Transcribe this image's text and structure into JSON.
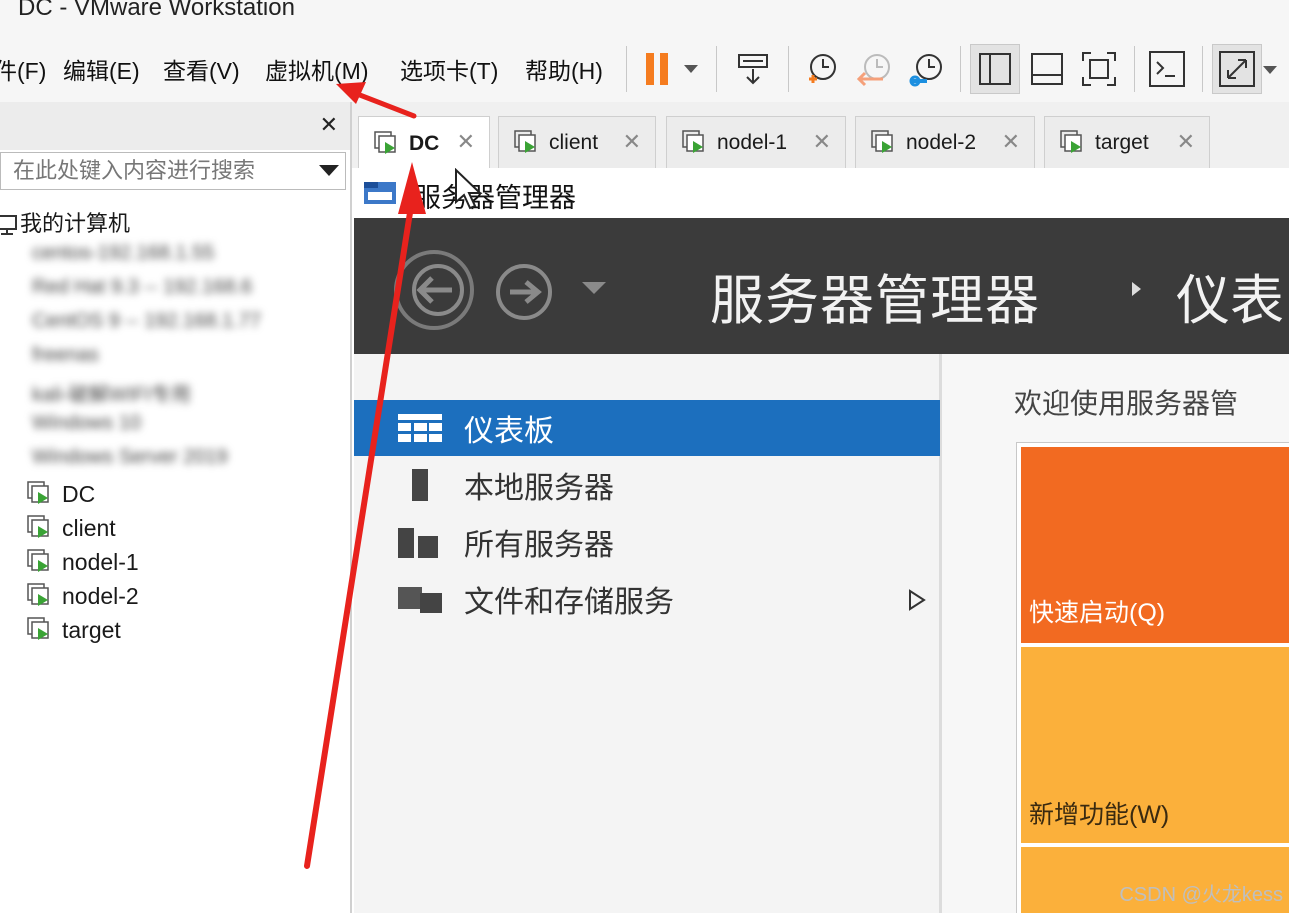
{
  "window": {
    "title": "DC - VMware Workstation"
  },
  "menu": {
    "items": [
      "件(F)",
      "编辑(E)",
      "查看(V)",
      "虚拟机(M)",
      "选项卡(T)",
      "帮助(H)"
    ]
  },
  "library": {
    "search_placeholder": "在此处键入内容进行搜索",
    "root_label": "我的计算机",
    "blurred_items": [
      "centos-192.168.1.55",
      "Red Hat 9.3 -- 192.168.6",
      "CentOS 9 -- 192.168.1.77",
      "freenas",
      "kali-破解WIFI专用",
      "Windows 10",
      "Windows Server 2019"
    ],
    "vms": [
      "DC",
      "client",
      "nodel-1",
      "nodel-2",
      "target"
    ]
  },
  "tabs": [
    {
      "label": "DC",
      "active": true
    },
    {
      "label": "client",
      "active": false
    },
    {
      "label": "nodel-1",
      "active": false
    },
    {
      "label": "nodel-2",
      "active": false
    },
    {
      "label": "target",
      "active": false
    }
  ],
  "vm_screen": {
    "window_title": "服务器管理器",
    "breadcrumb_main": "服务器管理器",
    "breadcrumb_sub": "仪表",
    "nav": [
      {
        "label": "仪表板",
        "selected": true
      },
      {
        "label": "本地服务器",
        "selected": false
      },
      {
        "label": "所有服务器",
        "selected": false
      },
      {
        "label": "文件和存储服务",
        "selected": false
      }
    ],
    "welcome": "欢迎使用服务器管",
    "tile_quick": "快速启动(Q)",
    "tile_new": "新增功能(W)"
  },
  "colors": {
    "accent_blue": "#1c6fbe",
    "pause_orange": "#f57c1f",
    "tile_orange": "#f26a21",
    "tile_yellow": "#fbb03b",
    "annotation_red": "#e8221d",
    "vm_green": "#3aa335"
  },
  "watermark": "CSDN @火龙kess"
}
